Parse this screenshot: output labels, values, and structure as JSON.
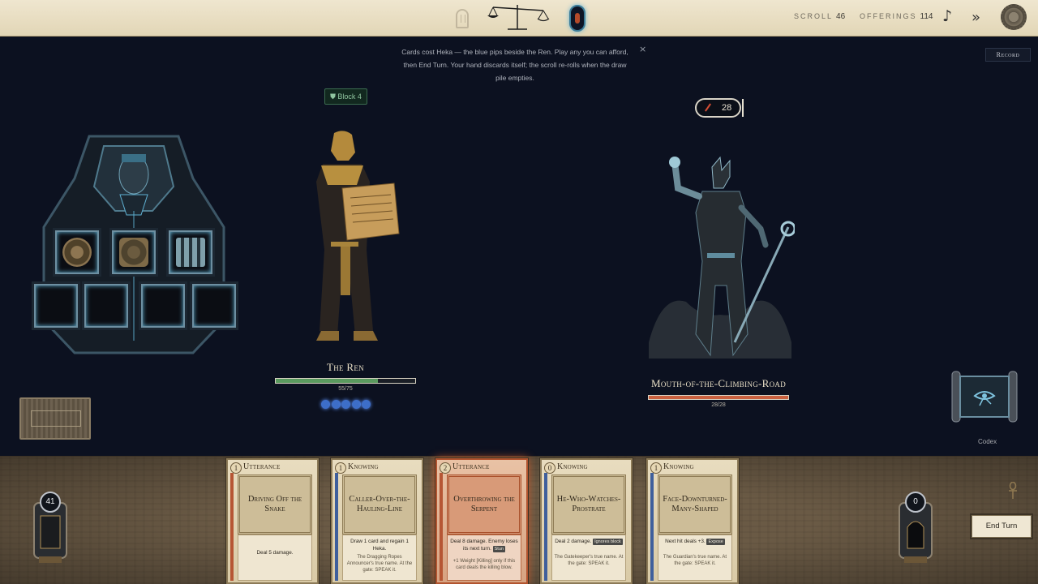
{
  "topbar": {
    "scroll_label": "SCROLL",
    "scroll_value": "46",
    "offerings_label": "OFFERINGS",
    "offerings_value": "114"
  },
  "hint": {
    "text": "Cards cost Heka — the blue pips beside the Ren. Play any you can afford, then End Turn. Your hand discards itself; the scroll re-rolls when the draw pile empties.",
    "close": "×"
  },
  "record_label": "Record",
  "player": {
    "block_label": "Block 4",
    "name": "The Ren",
    "hp_text": "55/75",
    "hp_fraction": 0.733,
    "heka_pips": 5
  },
  "enemy": {
    "name": "Mouth-of-the-Climbing-Road",
    "hp_text": "28/28",
    "hp_fraction": 1.0,
    "intent_value": "28"
  },
  "codex_label": "Codex",
  "draw_pile_count": "41",
  "discard_pile_count": "0",
  "end_turn_label": "End Turn",
  "colors": {
    "utterance_stripe": "#b65634",
    "knowing_stripe": "#3f5f9c",
    "hp_player": "#5a9a5e",
    "hp_enemy": "#c9603f"
  },
  "cards": [
    {
      "cost": "1",
      "type": "Utterance",
      "title": "Driving Off the Snake",
      "effect": "Deal 5 damage.",
      "tag": "",
      "flavor": ""
    },
    {
      "cost": "1",
      "type": "Knowing",
      "title": "Caller-Over-the-Hauling-Line",
      "effect": "Draw 1 card and regain 1 Heka.",
      "tag": "",
      "flavor": "The Dragging Ropes Announcer's true name. At the gate: SPEAK it."
    },
    {
      "cost": "2",
      "type": "Utterance",
      "title": "Overthrowing the Serpent",
      "effect": "Deal 8 damage. Enemy loses its next turn.",
      "tag": "Stun",
      "flavor": "+1 Weight [Killing] only if this card deals the killing blow."
    },
    {
      "cost": "0",
      "type": "Knowing",
      "title": "He-Who-Watches-Prostrate",
      "effect": "Deal 2 damage.",
      "tag": "Ignores block",
      "flavor": "The Gatekeeper's true name. At the gate: SPEAK it."
    },
    {
      "cost": "1",
      "type": "Knowing",
      "title": "Face-Downturned-Many-Shaped",
      "effect": "Next hit deals +3.",
      "tag": "Expose",
      "flavor": "The Guardian's true name. At the gate: SPEAK it."
    }
  ]
}
